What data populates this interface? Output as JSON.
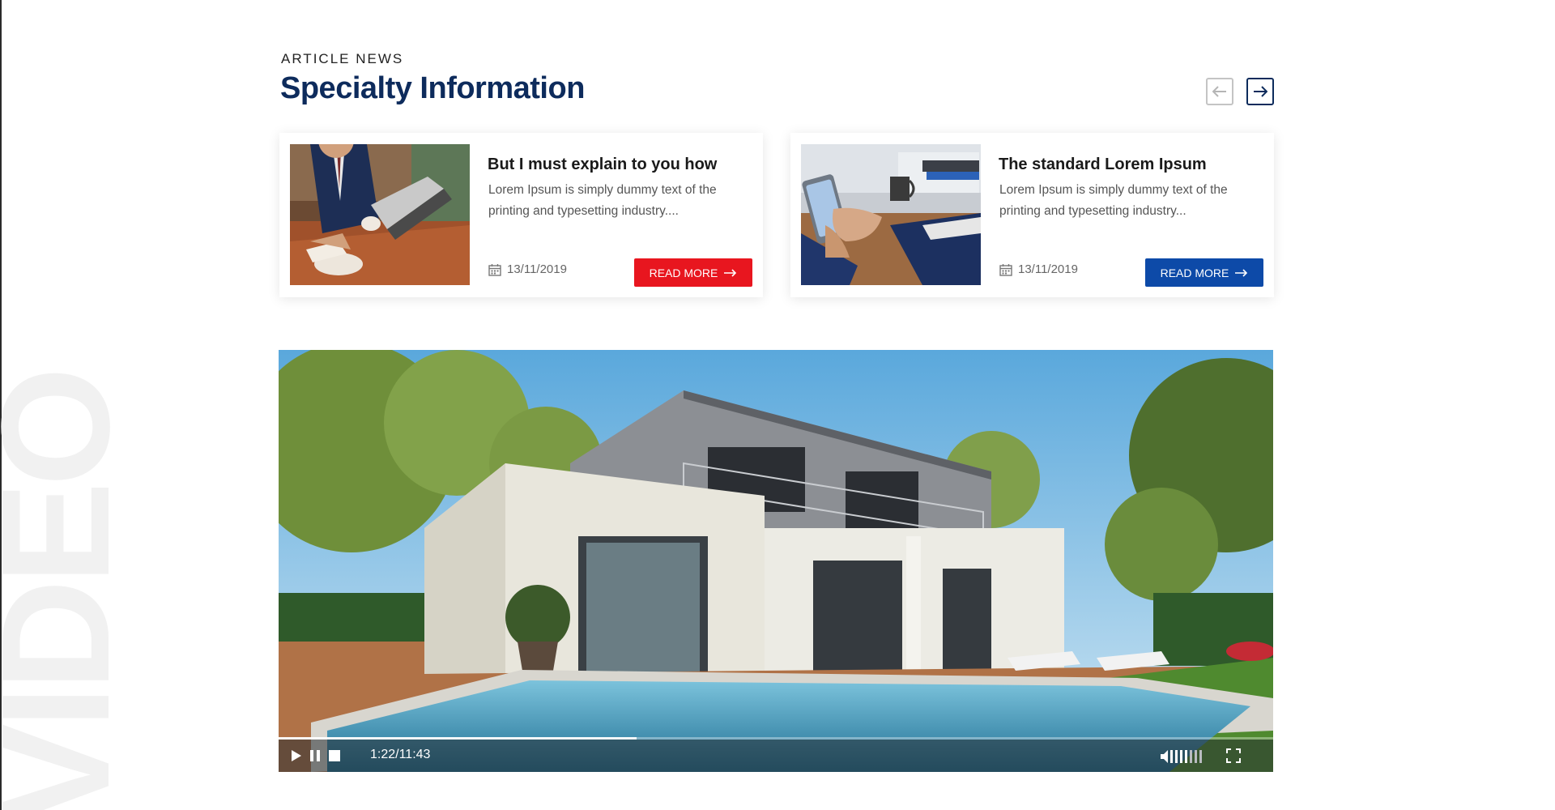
{
  "section": {
    "eyebrow": "ARTICLE NEWS",
    "title": "Specialty Information",
    "watermark": "VIDEO"
  },
  "carousel": {
    "prev_icon": "arrow-left-icon",
    "next_icon": "arrow-right-icon"
  },
  "articles": [
    {
      "title": "But I must explain to you how",
      "excerpt": "Lorem Ipsum is simply dummy text of the printing and typesetting industry....",
      "date": "13/11/2019",
      "button": "READ MORE",
      "button_color": "#e8161f",
      "image": "businessman-laptop-coffee"
    },
    {
      "title": "The standard Lorem Ipsum",
      "excerpt": "Lorem Ipsum is simply dummy text of the printing and typesetting industry...",
      "date": "13/11/2019",
      "button": "READ MORE",
      "button_color": "#0d4aa8",
      "image": "hands-smartphone-desk"
    }
  ],
  "video": {
    "time": "1:22/11:43",
    "progress": 0.36,
    "image": "modern-house-with-pool",
    "controls": [
      "play-icon",
      "pause-icon",
      "stop-icon",
      "volume-icon",
      "fullscreen-icon"
    ]
  },
  "colors": {
    "navy": "#0d2b5c",
    "red": "#e8161f",
    "blue": "#0d4aa8"
  }
}
